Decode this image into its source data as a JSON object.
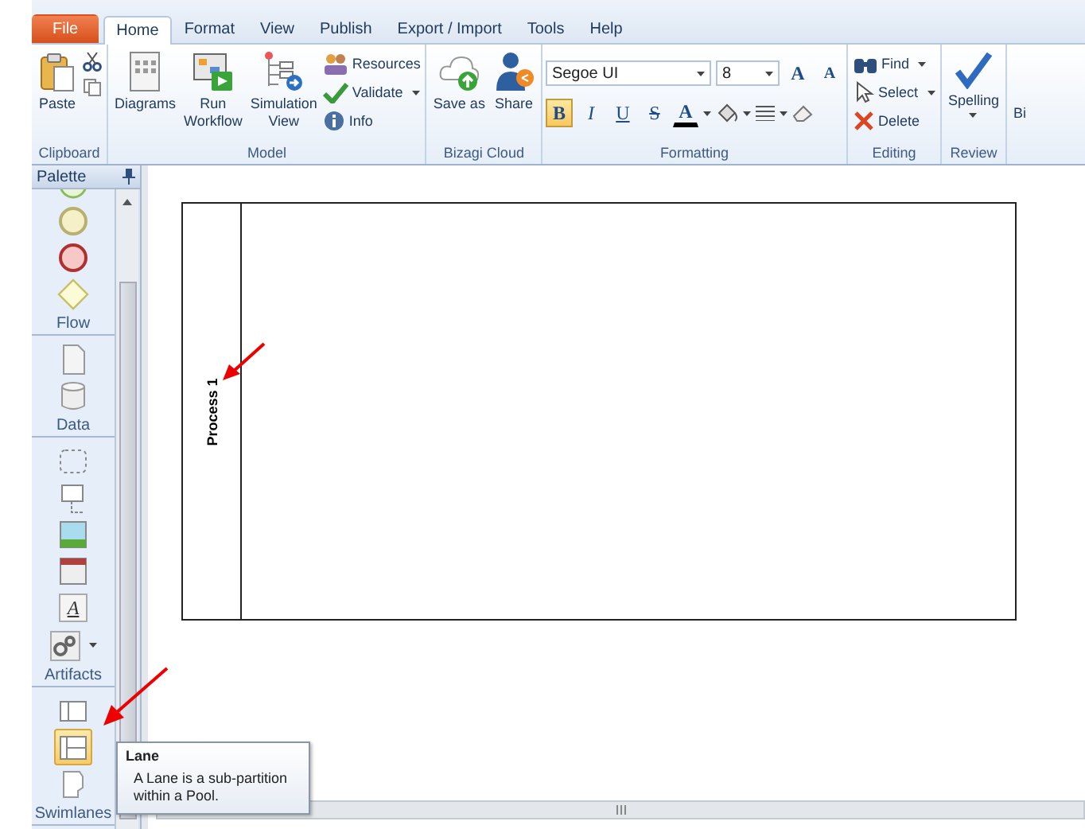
{
  "menu_tabs": [
    {
      "label": "File",
      "kind": "file",
      "selected": false
    },
    {
      "label": "Home",
      "kind": "tab",
      "selected": true
    },
    {
      "label": "Format",
      "kind": "tab",
      "selected": false
    },
    {
      "label": "View",
      "kind": "tab",
      "selected": false
    },
    {
      "label": "Publish",
      "kind": "tab",
      "selected": false
    },
    {
      "label": "Export / Import",
      "kind": "tab",
      "selected": false
    },
    {
      "label": "Tools",
      "kind": "tab",
      "selected": false
    },
    {
      "label": "Help",
      "kind": "tab",
      "selected": false
    }
  ],
  "ribbon_groups": [
    {
      "label": "Clipboard",
      "items": [
        {
          "kind": "large",
          "label": "Paste"
        },
        {
          "kind": "icons"
        }
      ]
    },
    {
      "label": "Model",
      "items": [
        {
          "kind": "large",
          "label": "Diagrams"
        },
        {
          "kind": "large",
          "label": "Run\nWorkflow"
        },
        {
          "kind": "large",
          "label": "Simulation\nView"
        },
        {
          "kind": "small-stack",
          "entries": [
            {
              "label": "Resources",
              "dropdown": false
            },
            {
              "label": "Validate",
              "dropdown": true
            },
            {
              "label": "Info",
              "dropdown": false
            }
          ]
        }
      ]
    },
    {
      "label": "Bizagi Cloud",
      "items": [
        {
          "kind": "large",
          "label": "Save as"
        },
        {
          "kind": "large",
          "label": "Share"
        }
      ]
    },
    {
      "label": "Formatting",
      "items": [
        {
          "kind": "formatting",
          "font": "Segoe UI",
          "size": "8",
          "grow": "A",
          "shrink": "A",
          "styles": [
            {
              "label": "B",
              "kind": "bold",
              "selected": true
            },
            {
              "label": "I",
              "kind": "italic",
              "selected": false
            },
            {
              "label": "U",
              "kind": "underline",
              "selected": false
            },
            {
              "label": "S",
              "kind": "strike",
              "selected": false
            }
          ],
          "font_color": "A"
        }
      ]
    },
    {
      "label": "Editing",
      "items": [
        {
          "kind": "small-stack",
          "entries": [
            {
              "label": "Find",
              "dropdown": true
            },
            {
              "label": "Select",
              "dropdown": true
            },
            {
              "label": "Delete",
              "dropdown": false
            }
          ]
        }
      ]
    },
    {
      "label": "Review",
      "items": [
        {
          "kind": "large",
          "label": "Spelling",
          "dropdown": true
        }
      ]
    },
    {
      "items": [
        {
          "kind": "cut",
          "label": "Bi"
        }
      ]
    }
  ],
  "palette": {
    "title": "Palette",
    "sections": [
      {
        "label": "Flow",
        "items": [
          {
            "kind": "start",
            "selected": false
          },
          {
            "kind": "intermediate",
            "selected": false
          },
          {
            "kind": "end",
            "selected": false
          },
          {
            "kind": "gateway",
            "selected": false
          }
        ]
      },
      {
        "label": "Data",
        "items": [
          {
            "kind": "document",
            "selected": false
          },
          {
            "kind": "store",
            "selected": false
          }
        ]
      },
      {
        "label": "Artifacts",
        "items": [
          {
            "kind": "group",
            "selected": false
          },
          {
            "kind": "annotation",
            "selected": false
          },
          {
            "kind": "image",
            "selected": false
          },
          {
            "kind": "form",
            "selected": false
          },
          {
            "kind": "text",
            "label": "A",
            "selected": false
          },
          {
            "kind": "gears",
            "selected": false
          }
        ]
      },
      {
        "label": "Swimlanes",
        "items": [
          {
            "kind": "pool",
            "selected": false
          },
          {
            "kind": "lane",
            "selected": true
          },
          {
            "kind": "page",
            "selected": false
          }
        ]
      }
    ]
  },
  "canvas": {
    "pool": {
      "label": "Process 1"
    }
  },
  "tooltip": {
    "title": "Lane",
    "text": "A Lane is a sub-partition within a Pool."
  }
}
